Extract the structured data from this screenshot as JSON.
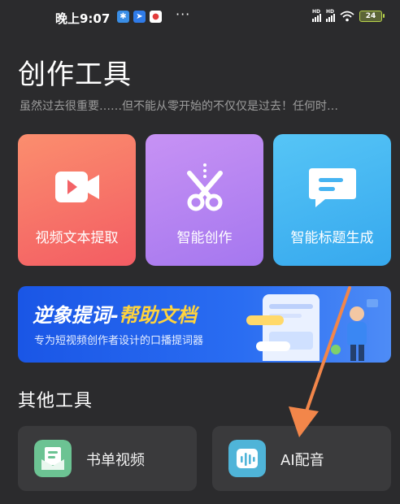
{
  "status_bar": {
    "time": "晚上9:07",
    "more": "···",
    "battery": "24",
    "hd": "HD"
  },
  "header": {
    "title": "创作工具",
    "subtitle": "虽然过去很重要……但不能从零开始的不仅仅是过去！任何时…"
  },
  "tools": [
    {
      "label": "视频文本提取",
      "icon": "video-play-icon",
      "color": "#f56d66"
    },
    {
      "label": "智能创作",
      "icon": "scissors-icon",
      "color": "#b485f2"
    },
    {
      "label": "智能标题生成",
      "icon": "message-bubble-icon",
      "color": "#45b6f3"
    }
  ],
  "banner": {
    "title_prefix": "逆象提词-",
    "title_highlight": "帮助文档",
    "subtitle": "专为短视频创作者设计的口播提词器"
  },
  "other_tools": {
    "section_title": "其他工具",
    "items": [
      {
        "label": "书单视频",
        "icon": "book-mail-icon",
        "color": "#6cc393"
      },
      {
        "label": "AI配音",
        "icon": "audio-wave-icon",
        "color": "#4fb4d8"
      }
    ]
  },
  "colors": {
    "background": "#2b2b2d",
    "card_dark": "#3a3a3c",
    "arrow": "#f2864a"
  }
}
